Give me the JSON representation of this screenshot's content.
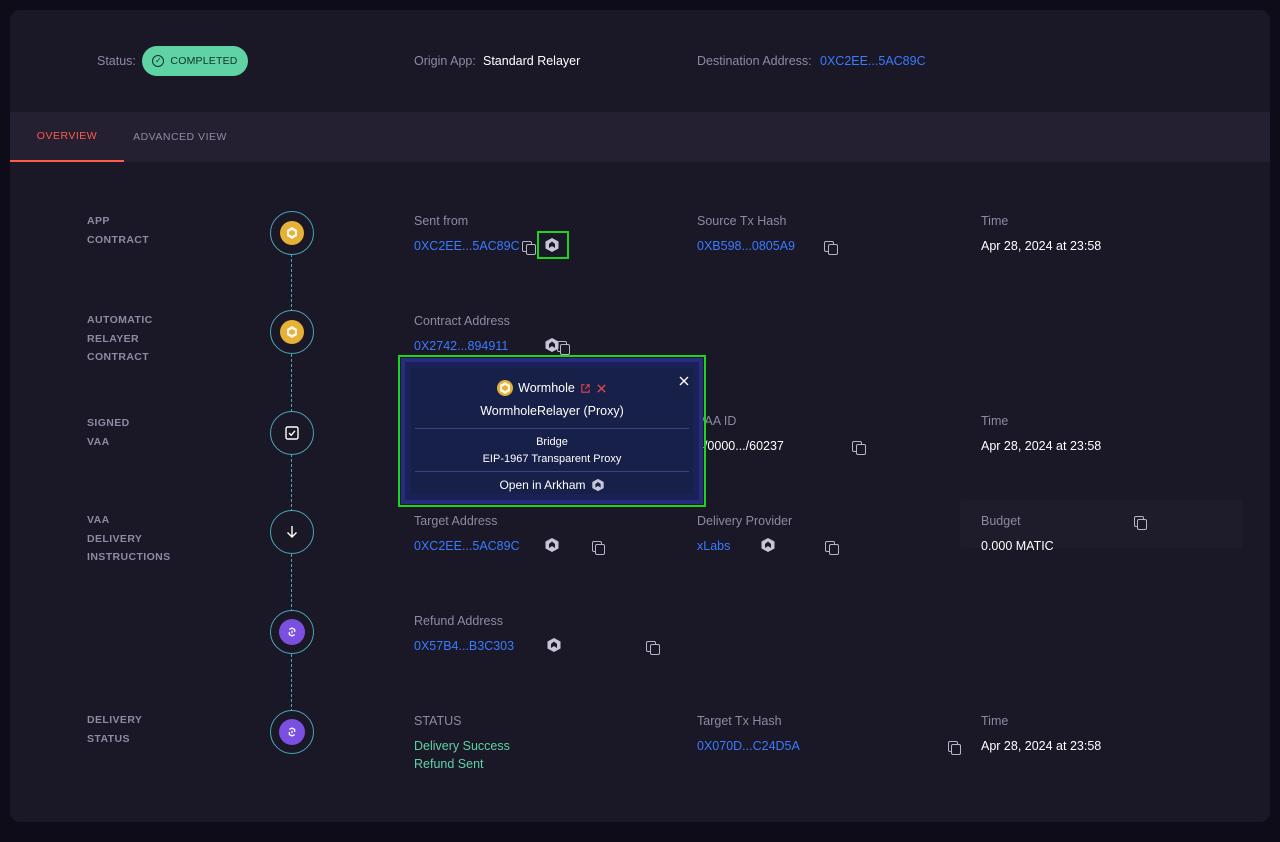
{
  "header": {
    "status_label": "Status:",
    "status_value": "COMPLETED",
    "origin_app_label": "Origin App:",
    "origin_app_value": "Standard Relayer",
    "destination_label": "Destination Address:",
    "destination_value": "0XC2EE...5AC89C"
  },
  "tabs": [
    {
      "label": "OVERVIEW",
      "active": true
    },
    {
      "label": "ADVANCED VIEW",
      "active": false
    }
  ],
  "sections": {
    "app_contract": {
      "title": [
        "APP",
        "CONTRACT"
      ],
      "node_icon": "token-coin-icon",
      "sent_from_label": "Sent from",
      "sent_from_value": "0XC2EE...5AC89C",
      "source_tx_label": "Source Tx Hash",
      "source_tx_value": "0XB598...0805A9",
      "time_label": "Time",
      "time_value": "Apr 28, 2024 at 23:58"
    },
    "relayer_contract": {
      "title": [
        "AUTOMATIC",
        "RELAYER",
        "CONTRACT"
      ],
      "node_icon": "token-coin-icon",
      "contract_label": "Contract Address",
      "contract_value": "0X2742...894911"
    },
    "signed_vaa": {
      "title": [
        "SIGNED",
        "VAA"
      ],
      "node_icon": "checkbox-icon",
      "vaa_id_label": "VAA ID",
      "vaa_id_value": "4/0000.../60237",
      "time_label": "Time",
      "time_value": "Apr 28, 2024 at 23:58"
    },
    "delivery_instructions": {
      "title": [
        "VAA",
        "DELIVERY",
        "INSTRUCTIONS"
      ],
      "node_icon": "arrow-down-icon",
      "target_label": "Target Address",
      "target_value": "0XC2EE...5AC89C",
      "provider_label": "Delivery Provider",
      "provider_value": "xLabs",
      "budget_label": "Budget",
      "budget_value": "0.000 MATIC"
    },
    "refund": {
      "node_icon": "polygon-icon",
      "refund_label": "Refund Address",
      "refund_value": "0X57B4...B3C303"
    },
    "delivery_status": {
      "title": [
        "DELIVERY",
        "STATUS"
      ],
      "node_icon": "polygon-icon",
      "status_label": "STATUS",
      "status_line1": "Delivery Success",
      "status_line2": "Refund Sent",
      "target_tx_label": "Target Tx Hash",
      "target_tx_value": "0X070D...C24D5A",
      "time_label": "Time",
      "time_value": "Apr 28, 2024 at 23:58"
    }
  },
  "popup": {
    "entity_name": "Wormhole",
    "contract_name": "WormholeRelayer (Proxy)",
    "tag1": "Bridge",
    "tag2": "EIP-1967 Transparent Proxy",
    "open_label": "Open in Arkham"
  },
  "colors": {
    "accent_link": "#3a7bff",
    "status_green": "#5fd3a4",
    "active_tab": "#ff5a4a",
    "highlight": "#1ed51e"
  }
}
